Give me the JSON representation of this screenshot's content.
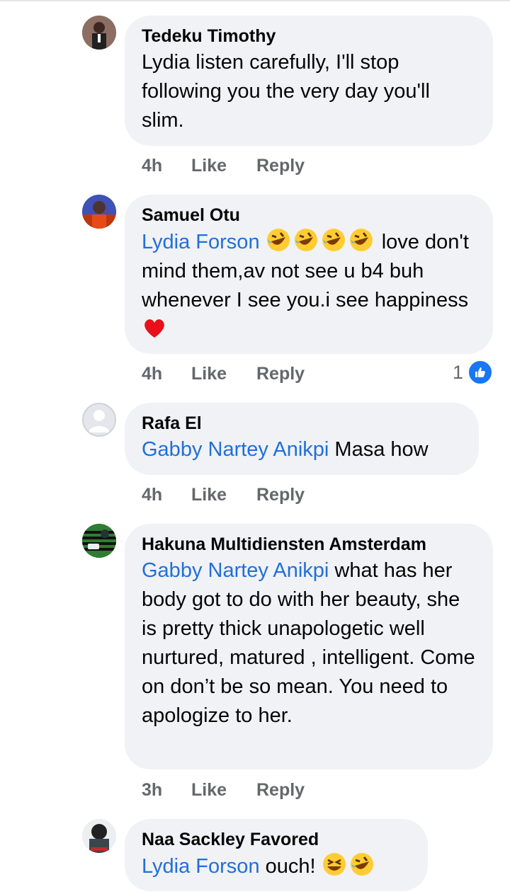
{
  "comments": [
    {
      "author": "Tedeku Timothy",
      "mention": "",
      "text": "Lydia listen carefully, I'll stop following you the very day you'll slim.",
      "time": "4h",
      "like": "Like",
      "reply": "Reply"
    },
    {
      "author": "Samuel Otu",
      "mention": "Lydia Forson",
      "text": " love don't mind them,av not see u b4 buh whenever I see you.i see happiness ",
      "time": "4h",
      "like": "Like",
      "reply": "Reply",
      "reaction_count": "1"
    },
    {
      "author": "Rafa El",
      "mention": "Gabby Nartey Anikpi",
      "text": " Masa how",
      "time": "4h",
      "like": "Like",
      "reply": "Reply"
    },
    {
      "author": "Hakuna Multidiensten Amsterdam",
      "mention": "Gabby Nartey Anikpi",
      "text": "  what has her body got to do with her beauty, she is pretty thick unapologetic well nurtured, matured , intelligent. Come on don’t be so mean. You need to apologize to her.",
      "time": "3h",
      "like": "Like",
      "reply": "Reply"
    },
    {
      "author": "Naa Sackley Favored",
      "mention": "Lydia Forson",
      "text": " ouch! ",
      "time": "",
      "like": "",
      "reply": ""
    }
  ],
  "icons": {
    "laugh_cry": "rolling-on-floor-laughing-emoji",
    "grin": "grinning-squinting-emoji",
    "heart": "red-heart-emoji",
    "like_badge": "thumbs-up-icon"
  },
  "colors": {
    "mention": "#216fdb",
    "bubble": "#f0f2f5",
    "meta": "#65676b",
    "like_badge": "#1877f2"
  }
}
